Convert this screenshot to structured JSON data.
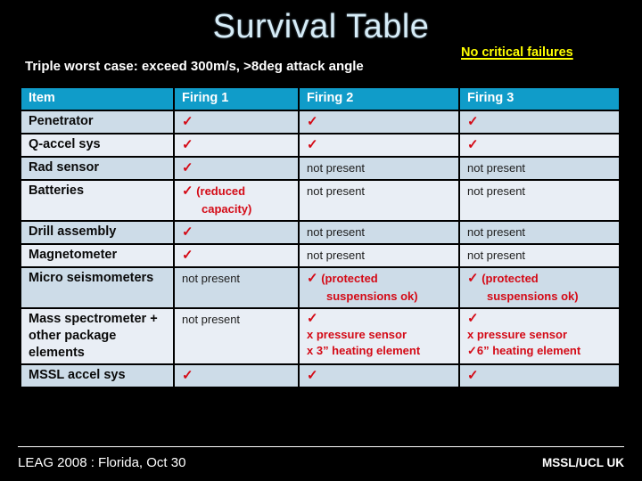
{
  "slide": {
    "title": "Survival Table",
    "subtitle": "Triple worst case: exceed 300m/s, >8deg attack angle",
    "critical_note": "No critical failures",
    "title_color": "#d6ecf7",
    "note_color": "#ffff00",
    "background_color": "#000000"
  },
  "table": {
    "header_bg": "#109cc9",
    "row_dark_bg": "#cddce8",
    "row_light_bg": "#e9eef5",
    "ok_color": "#d40a16",
    "tick_glyph": "✓",
    "headers": [
      "Item",
      "Firing 1",
      "Firing 2",
      "Firing 3"
    ],
    "rows": [
      {
        "item": "Penetrator",
        "f1": {
          "kind": "ok",
          "tick": "✓",
          "note": ""
        },
        "f2": {
          "kind": "ok",
          "tick": "✓",
          "note": ""
        },
        "f3": {
          "kind": "ok",
          "tick": "✓",
          "note": ""
        }
      },
      {
        "item": "Q-accel sys",
        "f1": {
          "kind": "ok",
          "tick": "✓",
          "note": ""
        },
        "f2": {
          "kind": "ok",
          "tick": "✓",
          "note": ""
        },
        "f3": {
          "kind": "ok",
          "tick": "✓",
          "note": ""
        }
      },
      {
        "item": "Rad sensor",
        "f1": {
          "kind": "ok",
          "tick": "✓",
          "note": ""
        },
        "f2": {
          "kind": "np",
          "text": "not present"
        },
        "f3": {
          "kind": "np",
          "text": "not present"
        }
      },
      {
        "item": "Batteries",
        "f1": {
          "kind": "ok",
          "tick": "✓",
          "note": "(reduced",
          "note2": "capacity)"
        },
        "f2": {
          "kind": "np",
          "text": "not present"
        },
        "f3": {
          "kind": "np",
          "text": "not present"
        }
      },
      {
        "item": "Drill assembly",
        "f1": {
          "kind": "ok",
          "tick": "✓",
          "note": ""
        },
        "f2": {
          "kind": "np",
          "text": "not present"
        },
        "f3": {
          "kind": "np",
          "text": "not present"
        }
      },
      {
        "item": "Magnetometer",
        "f1": {
          "kind": "ok",
          "tick": "✓",
          "note": ""
        },
        "f2": {
          "kind": "np",
          "text": "not present"
        },
        "f3": {
          "kind": "np",
          "text": "not present"
        }
      },
      {
        "item": "Micro seismometers",
        "f1": {
          "kind": "np",
          "text": "not present"
        },
        "f2": {
          "kind": "ok",
          "tick": "✓",
          "note": "(protected",
          "note2": "suspensions ok)"
        },
        "f3": {
          "kind": "ok",
          "tick": "✓",
          "note": "(protected",
          "note2": "suspensions ok)"
        }
      },
      {
        "item": "Mass spectrometer + other package elements",
        "f1": {
          "kind": "np",
          "text": "not present"
        },
        "f2": {
          "kind": "ok",
          "tick": "✓",
          "line2": "x pressure sensor",
          "line3": "x 3” heating  element"
        },
        "f3": {
          "kind": "ok",
          "tick": "✓",
          "line2": "x pressure sensor",
          "line3": "✓6” heating element"
        }
      },
      {
        "item": "MSSL accel sys",
        "f1": {
          "kind": "ok",
          "tick": "✓",
          "note": ""
        },
        "f2": {
          "kind": "ok",
          "tick": "✓",
          "note": ""
        },
        "f3": {
          "kind": "ok",
          "tick": "✓",
          "note": ""
        }
      }
    ]
  },
  "footer": {
    "left": "LEAG 2008 :  Florida, Oct 30",
    "right": "MSSL/UCL UK"
  }
}
